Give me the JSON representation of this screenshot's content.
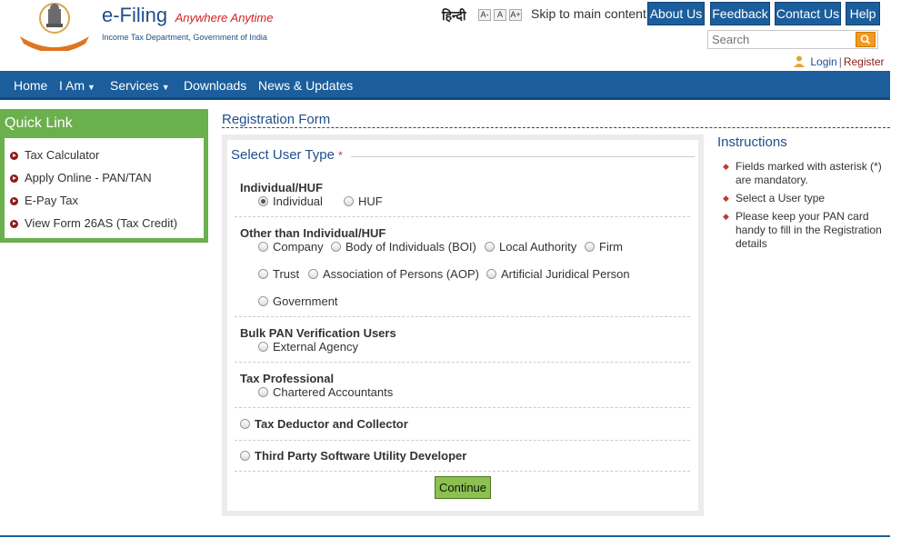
{
  "header": {
    "brand_main": "e-Filing",
    "brand_tag": "Anywhere Anytime",
    "brand_sub": "Income Tax Department, Government of India",
    "lang_link": "हिन्दी",
    "font_sizes": [
      "A-",
      "A",
      "A+"
    ],
    "skip_link": "Skip to main content",
    "buttons": [
      "About Us",
      "Feedback",
      "Contact Us",
      "Help"
    ],
    "search_placeholder": "Search",
    "login": "Login",
    "register": "Register"
  },
  "nav": {
    "items": [
      "Home",
      "I Am",
      "Services",
      "Downloads",
      "News & Updates"
    ]
  },
  "quick_link": {
    "title": "Quick Link",
    "items": [
      "Tax Calculator",
      "Apply Online - PAN/TAN",
      "E-Pay Tax",
      "View Form 26AS (Tax Credit)"
    ]
  },
  "form": {
    "title": "Registration Form",
    "section_title": "Select User Type",
    "required_mark": "*",
    "groups": {
      "individual": {
        "label": "Individual/HUF",
        "options": [
          "Individual",
          "HUF"
        ]
      },
      "other": {
        "label": "Other than Individual/HUF",
        "options": [
          "Company",
          "Body of Individuals (BOI)",
          "Local Authority",
          "Firm",
          "Trust",
          "Association of Persons (AOP)",
          "Artificial Juridical Person",
          "Government"
        ]
      },
      "bulk": {
        "label": "Bulk PAN Verification Users",
        "options": [
          "External Agency"
        ]
      },
      "taxpro": {
        "label": "Tax Professional",
        "options": [
          "Chartered Accountants"
        ]
      },
      "deductor": {
        "label": "Tax Deductor and Collector"
      },
      "thirdparty": {
        "label": "Third Party Software Utility Developer"
      }
    },
    "continue_label": "Continue"
  },
  "instructions": {
    "title": "Instructions",
    "items": [
      "Fields marked with asterisk (*) are mandatory.",
      "Select a User type",
      "Please keep your PAN card handy to fill in the Registration details"
    ]
  },
  "colors": {
    "primary": "#1b5e9b",
    "quick_link_green": "#6ab04c",
    "continue_green": "#8cc152",
    "accent_red": "#d02323"
  }
}
